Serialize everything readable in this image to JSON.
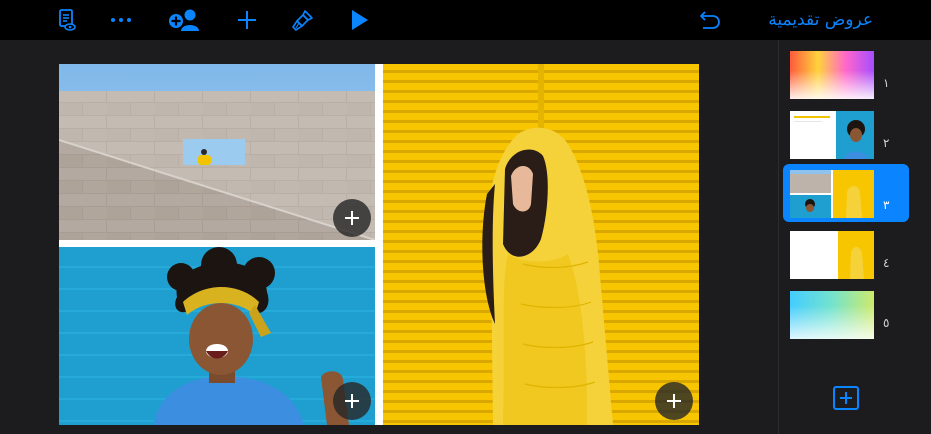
{
  "toolbar": {
    "title": "عروض تقديمية",
    "icons": [
      "slide-notes-icon",
      "more-icon",
      "collaborate-icon",
      "add-icon",
      "format-brush-icon",
      "play-icon",
      "undo-icon"
    ]
  },
  "navigator": {
    "slides": [
      {
        "number": "١",
        "selected": false
      },
      {
        "number": "٢",
        "selected": false
      },
      {
        "number": "٣",
        "selected": true
      },
      {
        "number": "٤",
        "selected": false
      },
      {
        "number": "٥",
        "selected": false
      }
    ]
  },
  "colors": {
    "accent": "#0a84ff",
    "toolbar_bg": "#000000",
    "panel_bg": "#1c1c1e",
    "slide_yellow": "#f7c600",
    "slide_blue": "#1f9fd0"
  }
}
